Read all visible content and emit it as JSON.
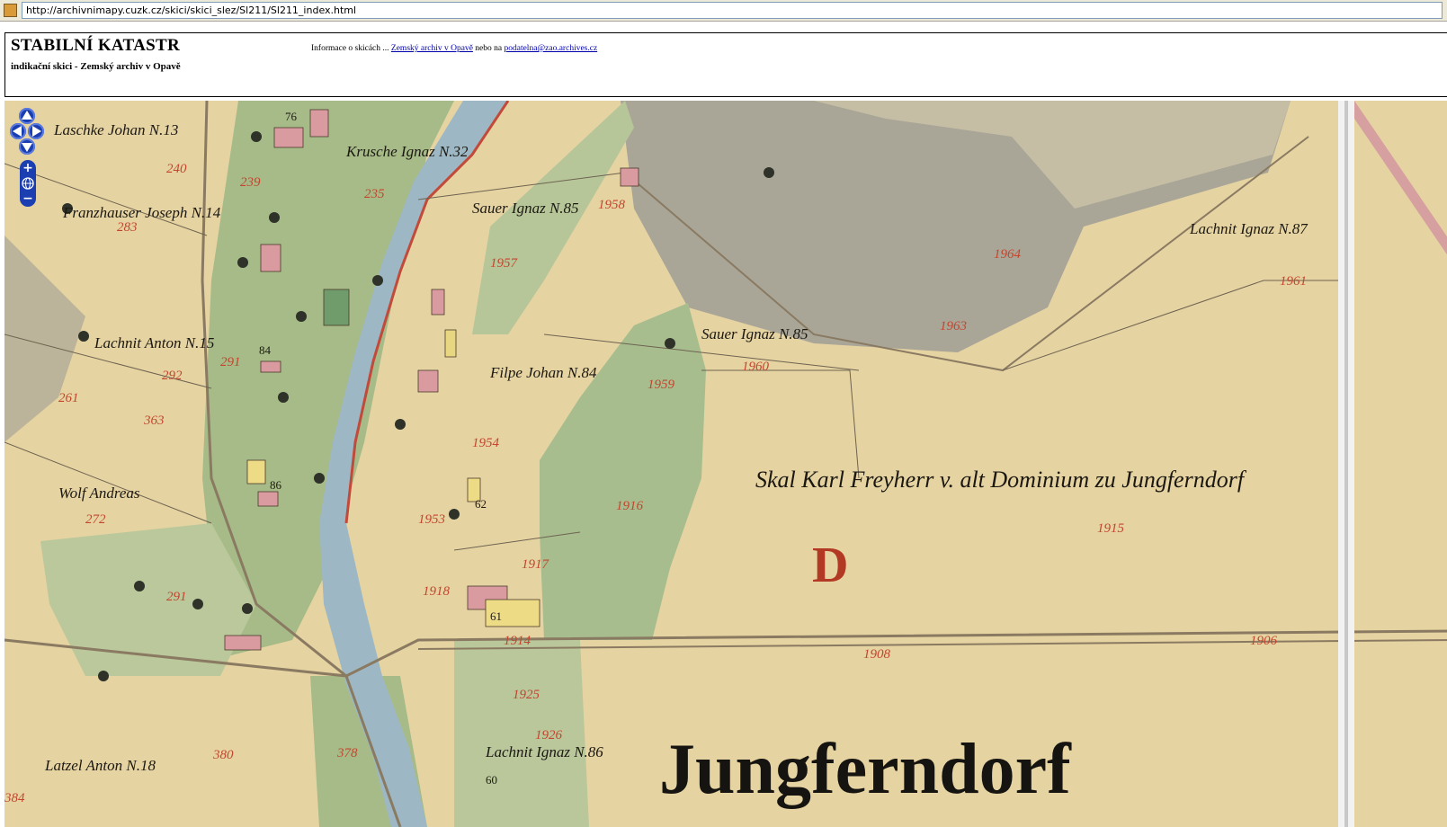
{
  "browser": {
    "url": "http://archivnimapy.cuzk.cz/skici/skici_slez/Sl211/Sl211_index.html"
  },
  "header": {
    "title": "STABILNÍ KATASTR",
    "subtitle": "indikační skici - Zemský archiv v Opavě",
    "info_prefix": "Informace o skicách ...",
    "info_link1": "Zemský archiv v Opavě",
    "info_middle": "nebo na",
    "info_link2": "podatelna@zao.archives.cz"
  },
  "map": {
    "labels": {
      "place_name": "Jungferndorf",
      "section_letter": "D",
      "dominium": "Skal Karl Freyherr v. alt Dominium zu Jungferndorf",
      "sauer85": "Sauer Ignaz N.85",
      "sauer85b": "Sauer Ignaz N.85",
      "lachnit87": "Lachnit Ignaz N.87",
      "lachnit86": "Lachnit Ignaz N.86",
      "lachnit15": "Lachnit Anton N.15",
      "filpe84": "Filpe Johan N.84",
      "krusche": "Krusche Ignaz N.32",
      "lasch": "Laschke Johan N.13",
      "franzhauser": "Franzhauser Joseph N.14",
      "wolf": "Wolf Andreas",
      "latzel": "Latzel Anton N.18"
    },
    "parcels": [
      "1957",
      "1964",
      "1961",
      "1960",
      "1959",
      "1954",
      "1916",
      "1915",
      "1917",
      "1918",
      "1925",
      "1926",
      "1914",
      "1906",
      "1908",
      "1963",
      "1953",
      "1958",
      "283",
      "240",
      "239",
      "235",
      "291",
      "292",
      "261",
      "363",
      "380",
      "272",
      "291",
      "384",
      "378"
    ],
    "houses": [
      "76",
      "84",
      "61",
      "60",
      "86",
      "62"
    ]
  },
  "controls": {
    "zoom_in": "+",
    "zoom_out": "−"
  }
}
